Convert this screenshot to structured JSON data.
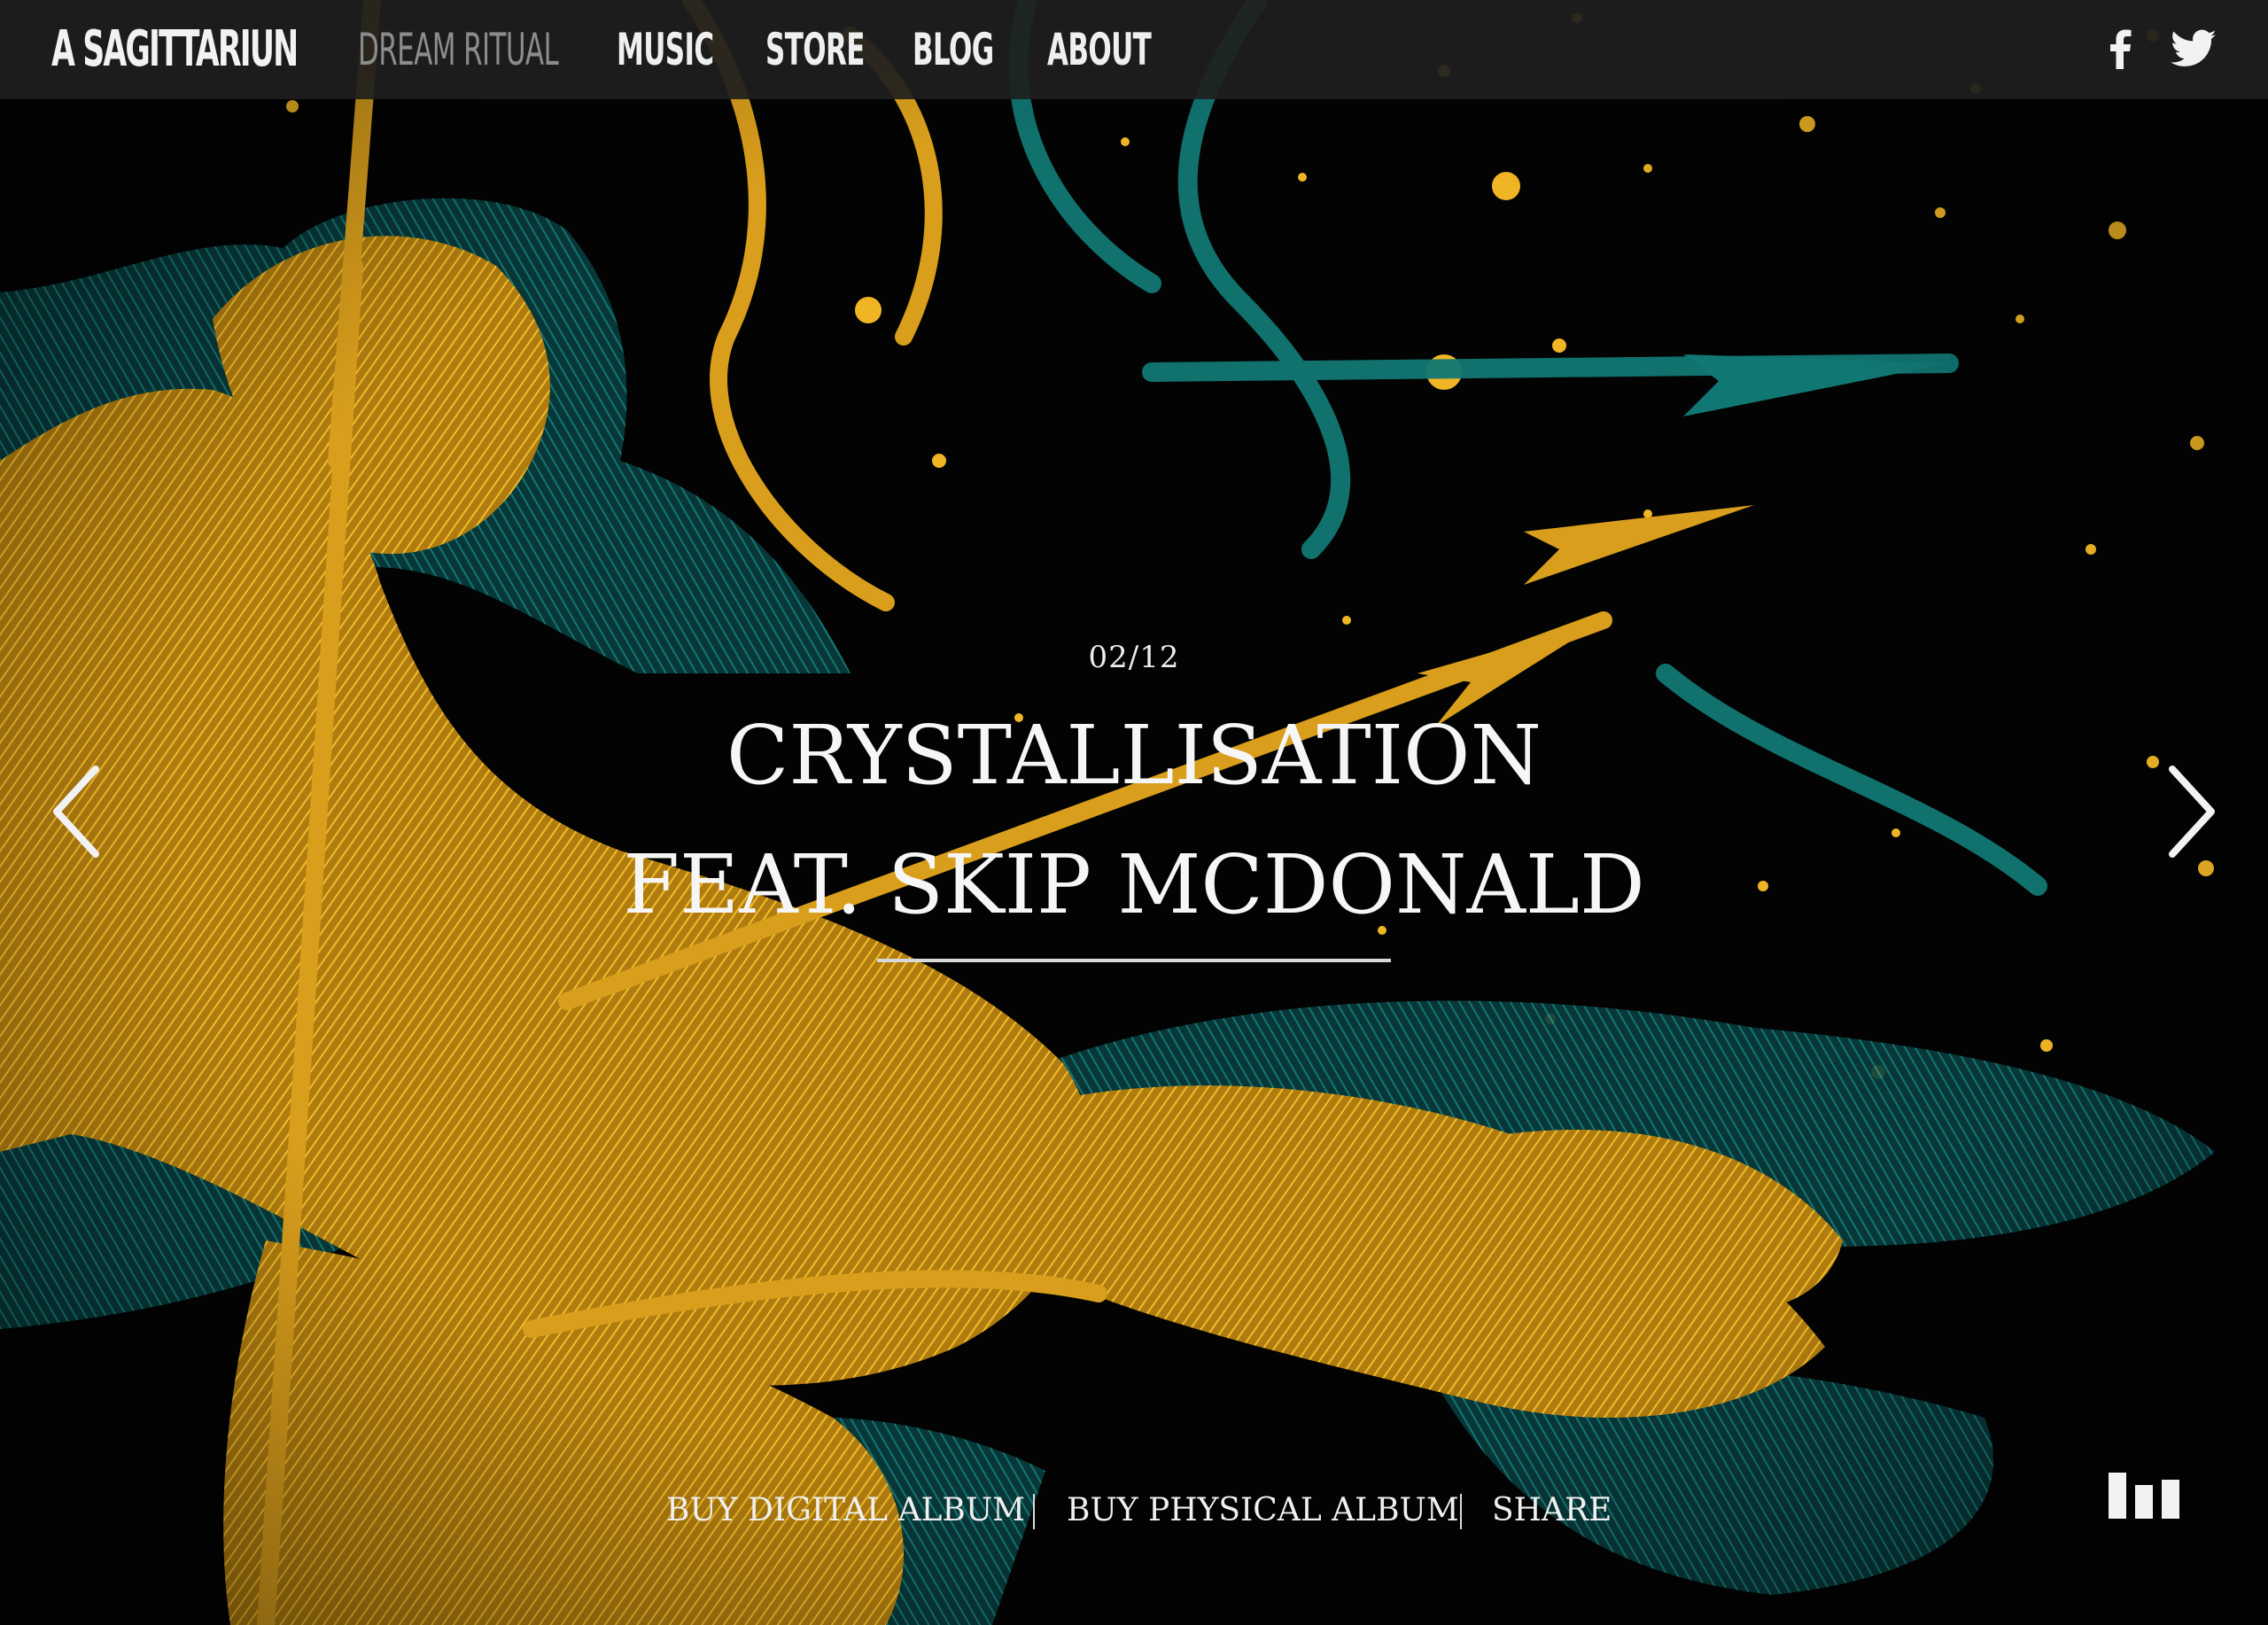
{
  "header": {
    "logo": "A SAGITTARIUN",
    "nav": [
      {
        "label": "DREAM RITUAL",
        "active": true
      },
      {
        "label": "MUSIC",
        "active": false
      },
      {
        "label": "STORE",
        "active": false
      },
      {
        "label": "BLOG",
        "active": false
      },
      {
        "label": "ABOUT",
        "active": false
      }
    ],
    "social": [
      "facebook-icon",
      "twitter-icon"
    ]
  },
  "slide": {
    "counter": "02/12",
    "title_line1": "CRYSTALLISATION",
    "title_line2": "FEAT. SKIP MCDONALD"
  },
  "actions": {
    "buy_digital": "BUY DIGITAL ALBUM",
    "buy_physical": "BUY PHYSICAL ALBUM",
    "share": "SHARE"
  },
  "colors": {
    "gold": "#e3a81e",
    "teal": "#0e6f6d",
    "background": "#030303",
    "topbar": "#1e1e1e"
  }
}
